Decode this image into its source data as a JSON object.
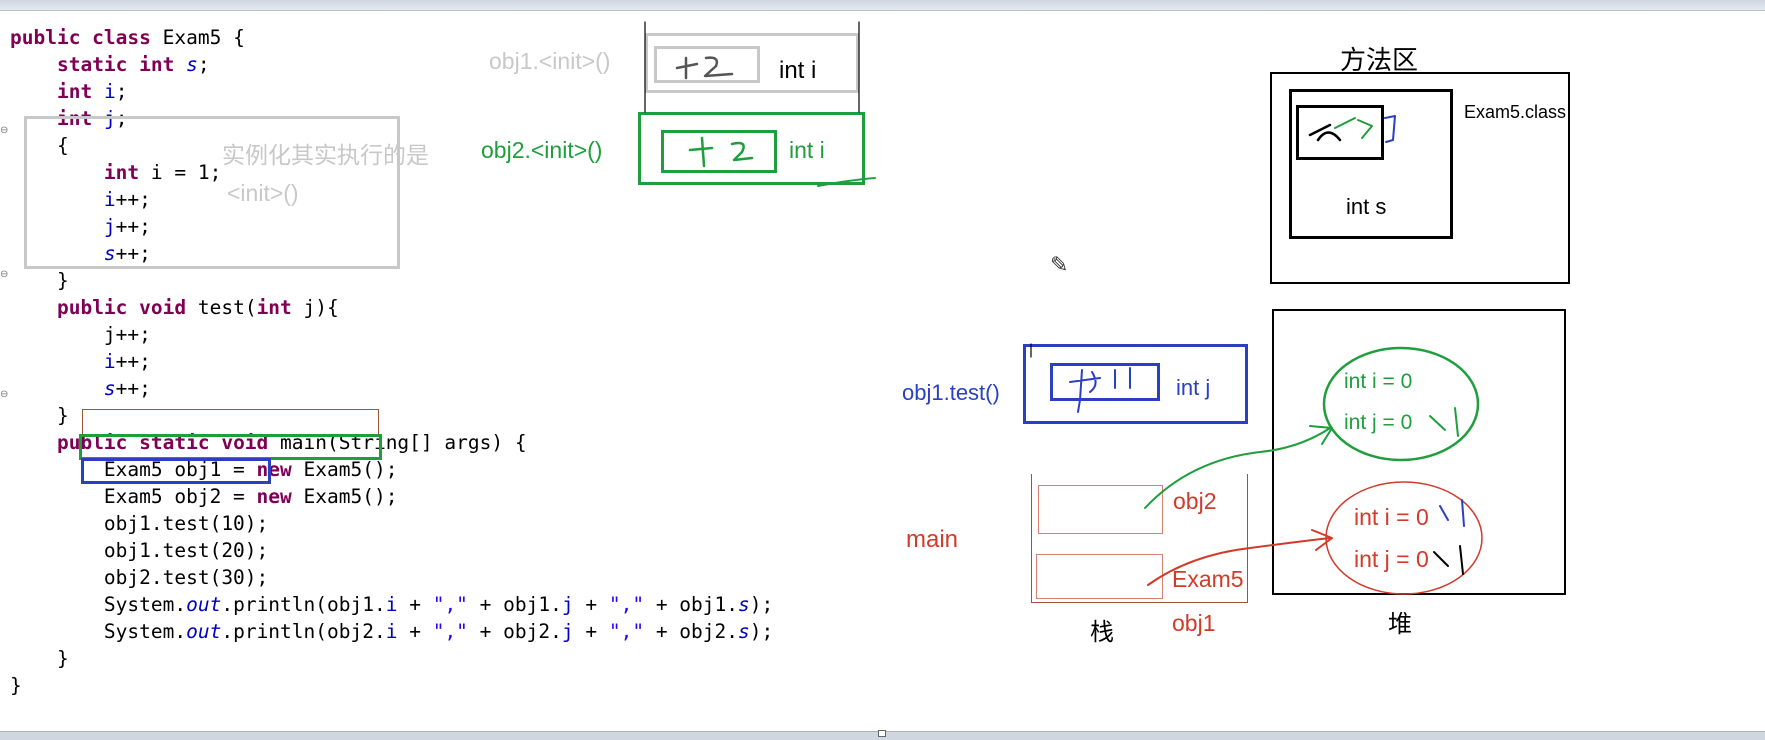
{
  "code": {
    "lines": [
      [
        [
          "kw",
          "public class "
        ],
        [
          "",
          "Exam5 {"
        ]
      ],
      [
        [
          "",
          "    "
        ],
        [
          "kw",
          "static int "
        ],
        [
          "sfld",
          "s"
        ],
        [
          "",
          ";"
        ]
      ],
      [
        [
          "",
          "    "
        ],
        [
          "kw",
          "int "
        ],
        [
          "fld",
          "i"
        ],
        [
          "",
          ";"
        ]
      ],
      [
        [
          "",
          "    "
        ],
        [
          "kw",
          "int "
        ],
        [
          "fld",
          "j"
        ],
        [
          "",
          ";"
        ]
      ],
      [
        [
          "",
          "    {"
        ]
      ],
      [
        [
          "",
          "        "
        ],
        [
          "kw",
          "int "
        ],
        [
          "",
          "i = 1;"
        ]
      ],
      [
        [
          "",
          "        "
        ],
        [
          "fld",
          "i"
        ],
        [
          "",
          "++;"
        ]
      ],
      [
        [
          "",
          "        "
        ],
        [
          "fld",
          "j"
        ],
        [
          "",
          "++;"
        ]
      ],
      [
        [
          "",
          "        "
        ],
        [
          "sfld",
          "s"
        ],
        [
          "",
          "++;"
        ]
      ],
      [
        [
          "",
          "    }"
        ]
      ],
      [
        [
          "",
          "    "
        ],
        [
          "kw",
          "public void "
        ],
        [
          "",
          "test("
        ],
        [
          "kw",
          "int "
        ],
        [
          "",
          "j){"
        ]
      ],
      [
        [
          "",
          "        j++;"
        ]
      ],
      [
        [
          "",
          "        "
        ],
        [
          "fld",
          "i"
        ],
        [
          "",
          "++;"
        ]
      ],
      [
        [
          "",
          "        "
        ],
        [
          "sfld",
          "s"
        ],
        [
          "",
          "++;"
        ]
      ],
      [
        [
          "",
          "    }"
        ]
      ],
      [
        [
          "",
          "    "
        ],
        [
          "kw",
          "public static void "
        ],
        [
          "",
          "main(String[] args) {"
        ]
      ],
      [
        [
          "",
          "        Exam5 obj1 = "
        ],
        [
          "kw",
          "new "
        ],
        [
          "",
          "Exam5();"
        ]
      ],
      [
        [
          "",
          "        Exam5 obj2 = "
        ],
        [
          "kw",
          "new "
        ],
        [
          "",
          "Exam5();"
        ]
      ],
      [
        [
          "",
          "        obj1.test(10);"
        ]
      ],
      [
        [
          "",
          "        obj1.test(20);"
        ]
      ],
      [
        [
          "",
          "        obj2.test(30);"
        ]
      ],
      [
        [
          "",
          "        System."
        ],
        [
          "sfld",
          "out"
        ],
        [
          "",
          ".println(obj1."
        ],
        [
          "fld",
          "i"
        ],
        [
          "",
          " + "
        ],
        [
          "str",
          "\",\""
        ],
        [
          "",
          " + obj1."
        ],
        [
          "fld",
          "j"
        ],
        [
          "",
          " + "
        ],
        [
          "str",
          "\",\""
        ],
        [
          "",
          " + obj1."
        ],
        [
          "sfld",
          "s"
        ],
        [
          "",
          ");"
        ]
      ],
      [
        [
          "",
          "        System."
        ],
        [
          "sfld",
          "out"
        ],
        [
          "",
          ".println(obj2."
        ],
        [
          "fld",
          "i"
        ],
        [
          "",
          " + "
        ],
        [
          "str",
          "\",\""
        ],
        [
          "",
          " + obj2."
        ],
        [
          "fld",
          "j"
        ],
        [
          "",
          " + "
        ],
        [
          "str",
          "\",\""
        ],
        [
          "",
          " + obj2."
        ],
        [
          "sfld",
          "s"
        ],
        [
          "",
          ");"
        ]
      ],
      [
        [
          "",
          "    }"
        ]
      ],
      [
        [
          "",
          "}"
        ]
      ]
    ],
    "fold_marker": "⊖"
  },
  "annotations": {
    "init_note_line1": "实例化其实执行的是",
    "init_note_line2": "<init>()",
    "obj1_init_label": "obj1.<init>()",
    "obj2_init_label": "obj2.<init>()",
    "obj1_test_label": "obj1.test()",
    "main_label": "main",
    "int_i_1": "int i",
    "int_i_2": "int i",
    "int_j": "int j",
    "method_area_title": "方法区",
    "exam5_class": "Exam5.class",
    "int_s": "int s",
    "stack_title": "栈",
    "heap_title": "堆",
    "stack_obj2": "obj2",
    "stack_exam5": "Exam5",
    "stack_obj1": "obj1",
    "heap_green_i": "int i = 0",
    "heap_green_j": "int j = 0",
    "heap_red_i": "int i = 0",
    "heap_red_j": "int j = 0"
  },
  "colors": {
    "gray": "#c8c8c8",
    "green": "#1e9e3c",
    "blue": "#2b3fc4",
    "red": "#d23a2a",
    "brown": "#a0523a"
  },
  "icons": {
    "pencil": "pencil-icon"
  }
}
